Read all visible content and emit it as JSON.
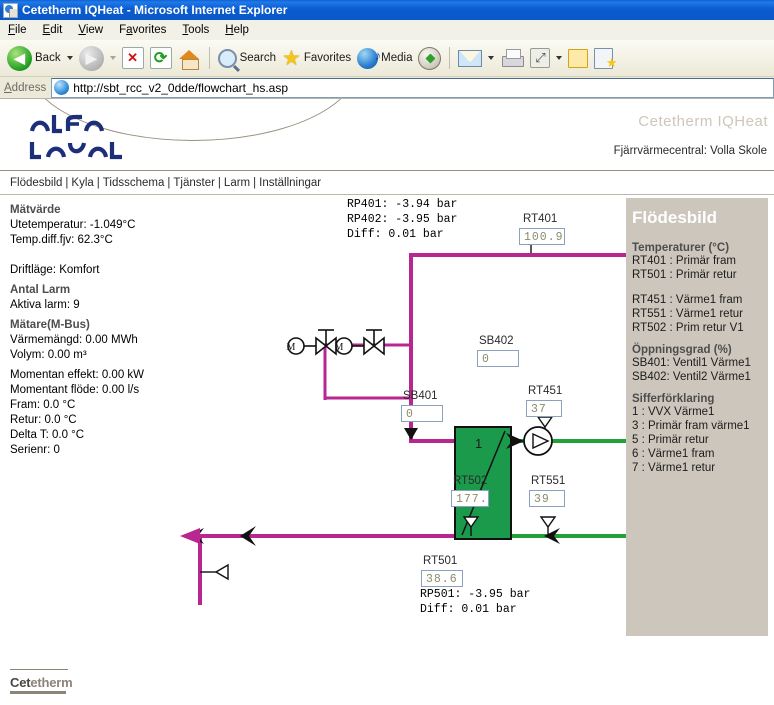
{
  "window": {
    "title": "Cetetherm IQHeat - Microsoft Internet Explorer",
    "icon": "ie-document-icon"
  },
  "menu": {
    "items": [
      "File",
      "Edit",
      "View",
      "Favorites",
      "Tools",
      "Help"
    ]
  },
  "toolbar": {
    "back_label": "Back",
    "search_label": "Search",
    "favorites_label": "Favorites",
    "media_label": "Media",
    "icons": [
      "back-arrow-icon",
      "forward-arrow-icon",
      "stop-icon",
      "refresh-icon",
      "home-icon",
      "search-icon",
      "favorites-star-icon",
      "media-icon",
      "history-icon",
      "mail-icon",
      "print-icon",
      "edit-icon",
      "messenger-icon",
      "notes-icon",
      "research-icon"
    ]
  },
  "address": {
    "label": "Address",
    "url": "http://sbt_rcc_v2_0dde/flowchart_hs.asp",
    "icon": "ie-globe-icon"
  },
  "header": {
    "logo_alt": "ALFA LAVAL",
    "brand": "Cetetherm IQHeat",
    "site": "Fjärrvärmecentral: Volla Skole"
  },
  "nav": {
    "items": [
      "Flödesbild",
      "Kyla",
      "Tidsschema",
      "Tjänster",
      "Larm",
      "Inställningar"
    ],
    "separator": "|"
  },
  "measurements": {
    "heading": "Mätvärde",
    "rows": [
      "Utetemperatur: -1.049°C",
      "Temp.diff.fjv: 62.3°C"
    ],
    "mode": "Driftläge: Komfort",
    "alarms_heading": "Antal Larm",
    "alarms_row": "Aktiva larm: 9",
    "meter_heading": "Mätare(M-Bus)",
    "meter_rows": [
      "Värmemängd: 0.00 MWh",
      "Volym: 0.00 m³"
    ],
    "meter_rows2": [
      "Momentan effekt: 0.00 kW",
      "Momentant flöde: 0.00 l/s",
      "Fram: 0.0 °C",
      "Retur: 0.0 °C",
      "Delta T: 0.0 °C",
      "Serienr: 0"
    ]
  },
  "pressures": {
    "rp401": "RP401: -3.94 bar",
    "rp402": "RP402: -3.95 bar",
    "diff_top": "Diff: 0.01 bar",
    "rp501": "RP501: -3.95 bar",
    "diff_bottom": "Diff: 0.01 bar"
  },
  "sensors": {
    "rt401": {
      "label": "RT401",
      "value": "100.9"
    },
    "rt451": {
      "label": "RT451",
      "value": "37"
    },
    "rt502": {
      "label": "RT502",
      "value": "177."
    },
    "rt551": {
      "label": "RT551",
      "value": "39"
    },
    "rt501": {
      "label": "RT501",
      "value": "38.6"
    },
    "sb401": {
      "label": "SB401",
      "value": "0"
    },
    "sb402": {
      "label": "SB402",
      "value": "0"
    },
    "exchanger_number": "1"
  },
  "infopanel": {
    "title": "Flödesbild",
    "sections": [
      {
        "heading": "Temperaturer (°C)",
        "lines": [
          "RT401 : Primär fram",
          "RT501 : Primär retur"
        ]
      },
      {
        "heading": "",
        "lines": [
          "RT451 : Värme1 fram",
          "RT551 : Värme1 retur",
          "RT502 : Prim retur V1"
        ]
      },
      {
        "heading": "Öppningsgrad (%)",
        "lines": [
          "SB401: Ventil1 Värme1",
          "SB402: Ventil2 Värme1"
        ]
      },
      {
        "heading": "Sifferförklaring",
        "lines": [
          "1 : VVX Värme1",
          "3 : Primär fram värme1",
          "5 : Primär retur",
          "6 : Värme1 fram",
          "7 : Värme1 retur"
        ]
      }
    ]
  },
  "footer": {
    "logo_dark": "Cet",
    "logo_light": "etherm"
  },
  "colors": {
    "primary_pipe": "#b8268f",
    "secondary_pipe": "#22a03a",
    "exchanger": "#1a9a4a",
    "panel_bg": "#cdc6bd",
    "value_text": "#8a8a6a",
    "titlebar": "#0a5cd0"
  }
}
